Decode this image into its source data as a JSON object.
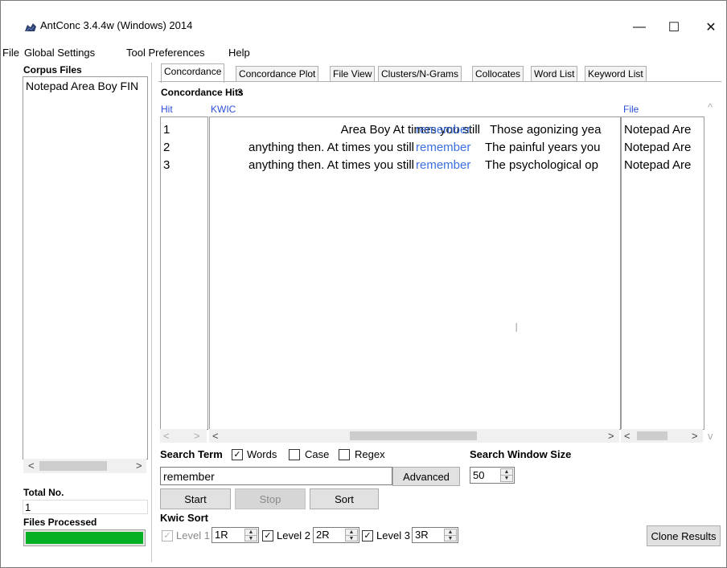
{
  "window": {
    "title": "AntConc 3.4.4w (Windows) 2014",
    "minimize": "—",
    "maximize": "☐",
    "close": "✕"
  },
  "menu": [
    "File",
    "Global Settings",
    "Tool Preferences",
    "Help"
  ],
  "left_panel": {
    "corpus_label": "Corpus Files",
    "corpus_files": [
      "Notepad Area Boy FIN"
    ],
    "total_label": "Total No.",
    "total_value": "1",
    "processed_label": "Files Processed",
    "processed_fraction": 1.0,
    "progress_color": "#06b025"
  },
  "tabs": [
    "Concordance",
    "Concordance Plot",
    "File View",
    "Clusters/N-Grams",
    "Collocates",
    "Word List",
    "Keyword List"
  ],
  "concordance": {
    "hits_label": "Concordance Hits",
    "hits_count": "3",
    "col_hit": "Hit",
    "col_kwic": "KWIC",
    "col_file": "File",
    "rows": [
      {
        "hit": "1",
        "left": "Area Boy  At times you still",
        "kw": "remember",
        "right": "Those agonizing yea",
        "file": "Notepad Are"
      },
      {
        "hit": "2",
        "left": "anything then. At times you still",
        "kw": "remember",
        "right": "The painful years you",
        "file": "Notepad Are"
      },
      {
        "hit": "3",
        "left": "anything then. At times you still",
        "kw": "remember",
        "right": "The psychological op",
        "file": "Notepad Are"
      }
    ],
    "keyword_color": "#3b6fe0"
  },
  "search": {
    "term_label": "Search Term",
    "words_label": "Words",
    "words_checked": true,
    "case_label": "Case",
    "case_checked": false,
    "regex_label": "Regex",
    "regex_checked": false,
    "value": "remember",
    "advanced_label": "Advanced",
    "window_size_label": "Search Window Size",
    "window_size_value": "50",
    "start_label": "Start",
    "stop_label": "Stop",
    "sort_label": "Sort"
  },
  "kwic_sort": {
    "label": "Kwic Sort",
    "level1_label": "Level 1",
    "level1_value": "1R",
    "level2_label": "Level 2",
    "level2_value": "2R",
    "level3_label": "Level 3",
    "level3_value": "3R",
    "clone_label": "Clone Results"
  },
  "glyphs": {
    "check": "✓",
    "left": "<",
    "right": ">",
    "up": "▲",
    "down": "▼",
    "scroll_up": "^",
    "scroll_down": "v"
  }
}
